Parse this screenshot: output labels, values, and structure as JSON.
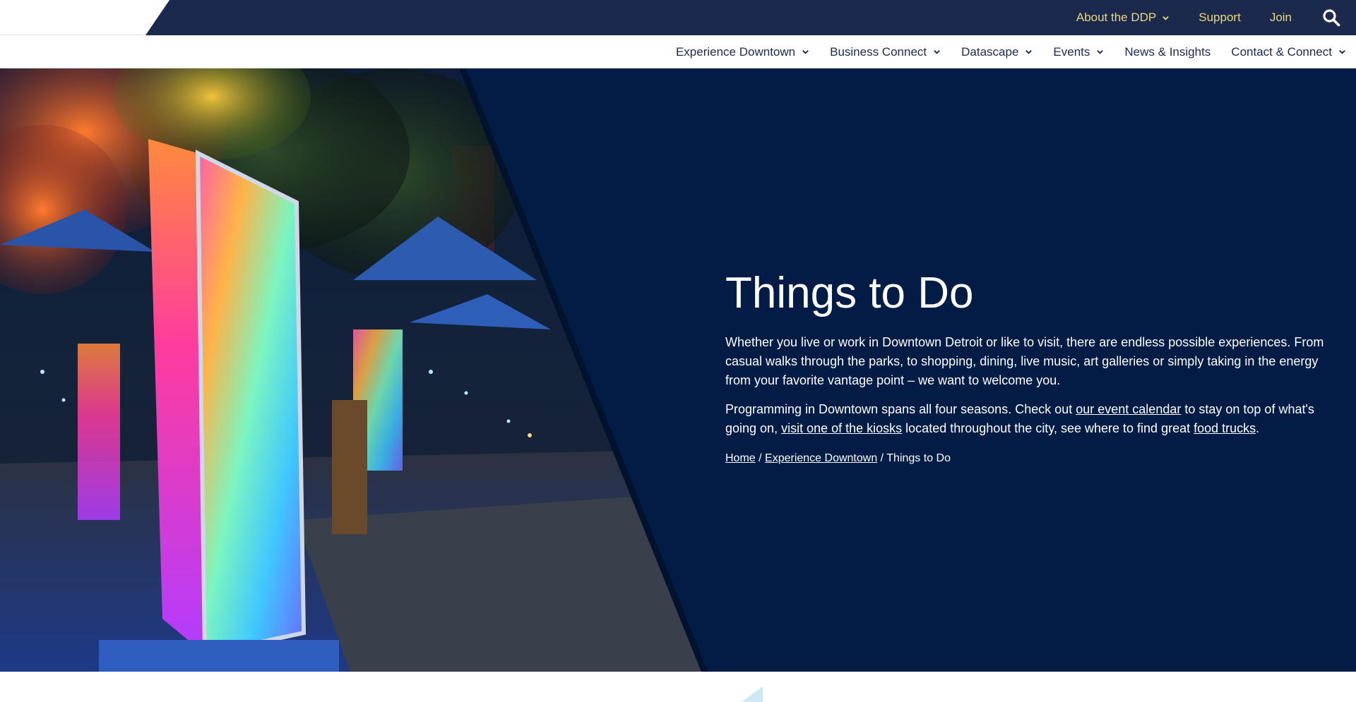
{
  "utility_nav": {
    "links": [
      {
        "label": "About the DDP",
        "has_dropdown": true
      },
      {
        "label": "Support",
        "has_dropdown": false
      },
      {
        "label": "Join",
        "has_dropdown": false
      }
    ],
    "search_icon": "search-icon"
  },
  "main_nav": {
    "items": [
      {
        "label": "Experience Downtown",
        "has_dropdown": true
      },
      {
        "label": "Business Connect",
        "has_dropdown": true
      },
      {
        "label": "Datascape",
        "has_dropdown": true
      },
      {
        "label": "Events",
        "has_dropdown": true
      },
      {
        "label": "News & Insights",
        "has_dropdown": false
      },
      {
        "label": "Contact & Connect",
        "has_dropdown": true
      }
    ]
  },
  "hero": {
    "title": "Things to Do",
    "paragraph1": "Whether you live or work in Downtown Detroit or like to visit, there are endless possible experiences. From casual walks through the parks, to shopping, dining, live music, art galleries or simply taking in the energy from your favorite vantage point – we want to welcome you.",
    "paragraph2": {
      "text_before": "Programming in Downtown spans all four seasons. Check out ",
      "link_event_calendar": "our event calendar",
      "text_mid1": " to stay on top of what's going on, ",
      "link_kiosks": "visit one of the kiosks",
      "text_mid2": " located throughout the city, see where to find great ",
      "link_food_trucks": "food trucks",
      "text_after": "."
    },
    "breadcrumb": {
      "home": "Home",
      "sep1": " / ",
      "parent": "Experience Downtown",
      "sep2": " / ",
      "current": "Things to Do"
    }
  },
  "colors": {
    "utility_bar": "#1b2a4c",
    "utility_link": "#e8d87a",
    "hero_background": "#021c45",
    "nav_text": "#1b2a4c"
  }
}
